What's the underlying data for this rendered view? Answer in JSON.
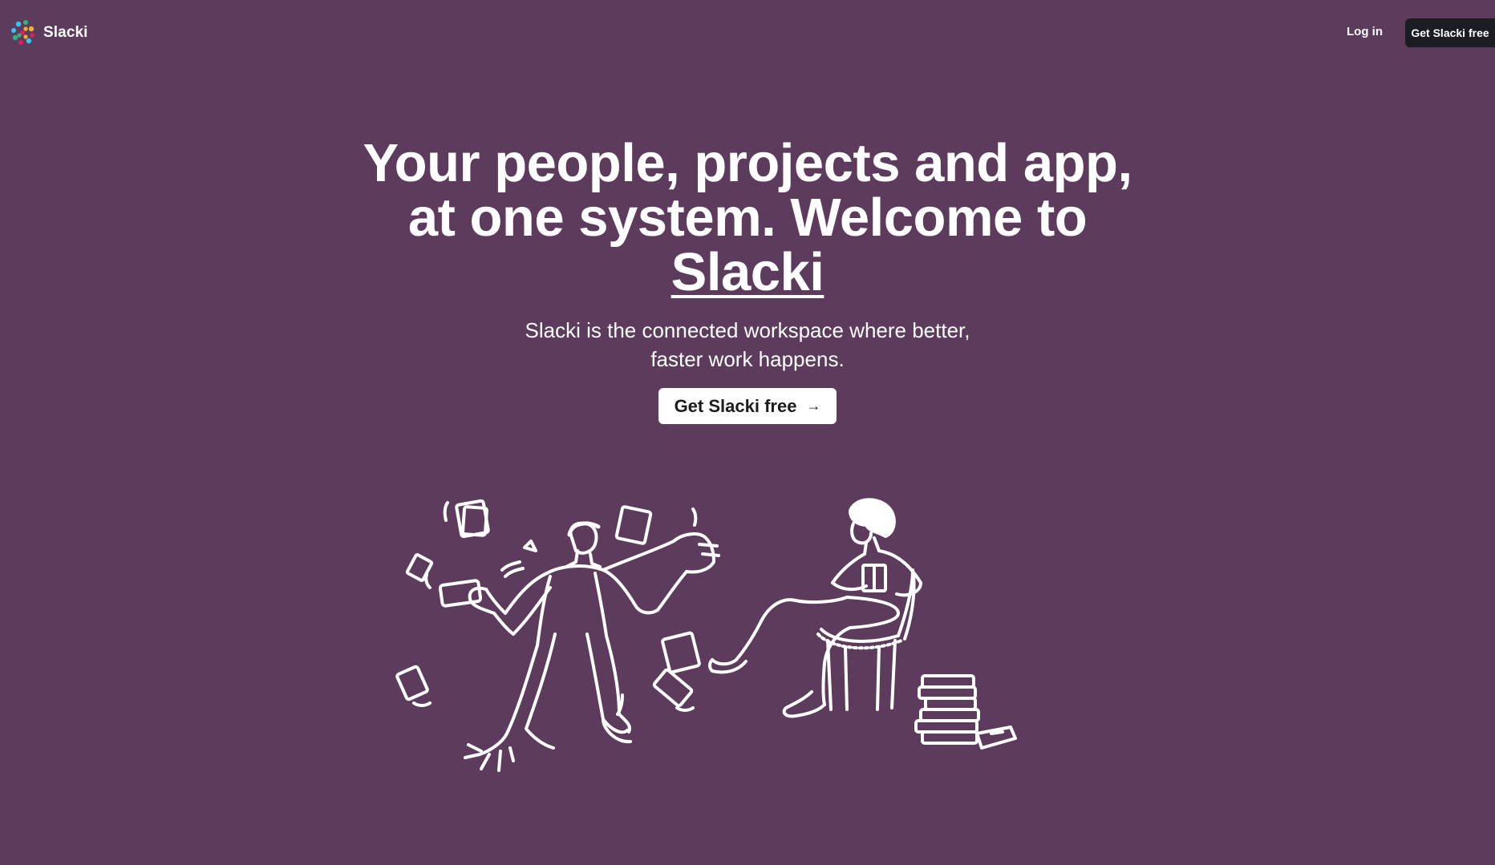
{
  "header": {
    "logo_text": "Slacki",
    "login_label": "Log in",
    "cta_label": "Get Slacki free"
  },
  "hero": {
    "title_line_1": "Your people, projects and app,",
    "title_line_2": "at one system. Welcome to",
    "title_brand": "Slacki",
    "subtitle": "Slacki is the connected workspace where better, faster work happens.",
    "cta_label": "Get Slacki free",
    "cta_arrow": "→"
  },
  "colors": {
    "background": "#5d3b5c",
    "nav_button": "#1a1d21",
    "text": "#ffffff",
    "cta_text": "#1d1c1d"
  },
  "icons": {
    "logo": "slacki-logo-icon",
    "arrow": "arrow-right-icon"
  },
  "illustration": {
    "subject": "juggling-man-and-reading-woman-illustration"
  }
}
